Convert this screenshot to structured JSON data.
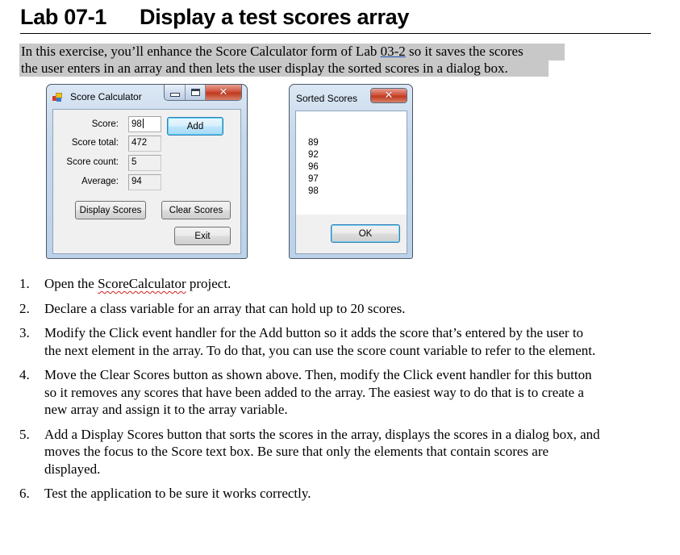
{
  "heading": {
    "lab_number": "Lab 07-1",
    "title": "Display a test scores array"
  },
  "intro": {
    "line1_before": "In this exercise, you’ll enhance the Score Calculator form of Lab ",
    "line1_link": "03-2",
    "line1_after": " so it saves the scores",
    "line2": "the user enters in an array and then lets the user display the sorted scores in a dialog box."
  },
  "score_calculator": {
    "window_title": "Score Calculator",
    "icons": {
      "app": "winforms-app-icon",
      "minimize": "minimize-icon",
      "maximize": "maximize-icon",
      "close": "close-icon"
    },
    "fields": {
      "score": {
        "label": "Score:",
        "value": "98"
      },
      "score_total": {
        "label": "Score total:",
        "value": "472"
      },
      "score_count": {
        "label": "Score count:",
        "value": "5"
      },
      "average": {
        "label": "Average:",
        "value": "94"
      }
    },
    "buttons": {
      "add": "Add",
      "display_scores": "Display Scores",
      "clear_scores": "Clear Scores",
      "exit": "Exit"
    }
  },
  "sorted_scores_dialog": {
    "window_title": "Sorted Scores",
    "scores": [
      "89",
      "92",
      "96",
      "97",
      "98"
    ],
    "ok_button": "OK"
  },
  "steps": [
    {
      "num": "1.",
      "before": "Open the ",
      "misspelled": "ScoreCalculator",
      "after": " project."
    },
    {
      "num": "2.",
      "text": "Declare a class variable for an array that can hold up to 20 scores."
    },
    {
      "num": "3.",
      "text": "Modify the Click event handler for the Add button so it adds the score that’s entered by the user to the next element in the array. To do that, you can use the score count variable to refer to the element."
    },
    {
      "num": "4.",
      "text": "Move the Clear Scores button as shown above. Then, modify the Click event handler for this button so it removes any scores that have been added to the array. The easiest way to do that is to create a new array and assign it to the array variable."
    },
    {
      "num": "5.",
      "text": "Add a Display Scores button that sorts the scores in the array, displays the scores in a dialog box, and moves the focus to the Score text box. Be sure that only the elements that contain scores are displayed."
    },
    {
      "num": "6.",
      "text": "Test the application to be sure it works correctly."
    }
  ]
}
